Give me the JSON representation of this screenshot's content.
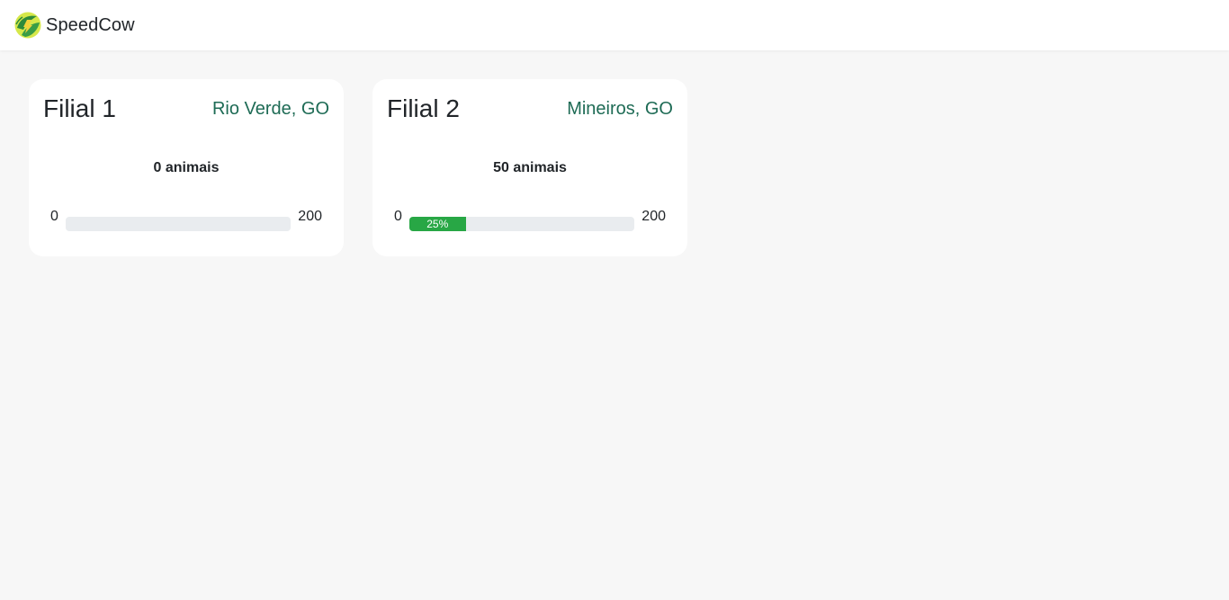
{
  "app": {
    "name": "SpeedCow"
  },
  "colors": {
    "location_text": "#1e6b55",
    "progress_fill": "#28a745",
    "progress_track": "#e9ecef"
  },
  "branches": [
    {
      "title": "Filial 1",
      "location": "Rio Verde, GO",
      "count_label": "0 animais",
      "min": "0",
      "max": "200",
      "progress_percent": 0,
      "progress_label": ""
    },
    {
      "title": "Filial 2",
      "location": "Mineiros, GO",
      "count_label": "50 animais",
      "min": "0",
      "max": "200",
      "progress_percent": 25,
      "progress_label": "25%"
    }
  ]
}
